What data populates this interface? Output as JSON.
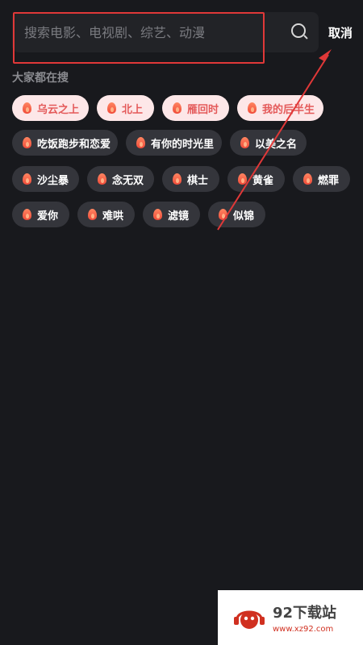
{
  "search": {
    "placeholder": "搜索电影、电视剧、综艺、动漫",
    "icon": "search-icon",
    "cancel_label": "取消"
  },
  "section_title": "大家都在搜",
  "chips": [
    {
      "label": "乌云之上",
      "hot": true
    },
    {
      "label": "北上",
      "hot": true
    },
    {
      "label": "雁回时",
      "hot": true
    },
    {
      "label": "我的后半生",
      "hot": true
    },
    {
      "label": "吃饭跑步和恋爱",
      "hot": false
    },
    {
      "label": "有你的时光里",
      "hot": false
    },
    {
      "label": "以美之名",
      "hot": false
    },
    {
      "label": "沙尘暴",
      "hot": false
    },
    {
      "label": "念无双",
      "hot": false
    },
    {
      "label": "棋士",
      "hot": false
    },
    {
      "label": "黄雀",
      "hot": false
    },
    {
      "label": "燃罪",
      "hot": false
    },
    {
      "label": "爱你",
      "hot": false
    },
    {
      "label": "难哄",
      "hot": false
    },
    {
      "label": "滤镜",
      "hot": false
    },
    {
      "label": "似锦",
      "hot": false
    }
  ],
  "colors": {
    "background": "#18191d",
    "hot_chip_bg": "#fde7e8",
    "hot_chip_text": "#e45a5a",
    "chip_bg": "#34353b",
    "annotation": "#e03838"
  },
  "watermark": {
    "title": "92下载站",
    "url": "www.xz92.com"
  }
}
